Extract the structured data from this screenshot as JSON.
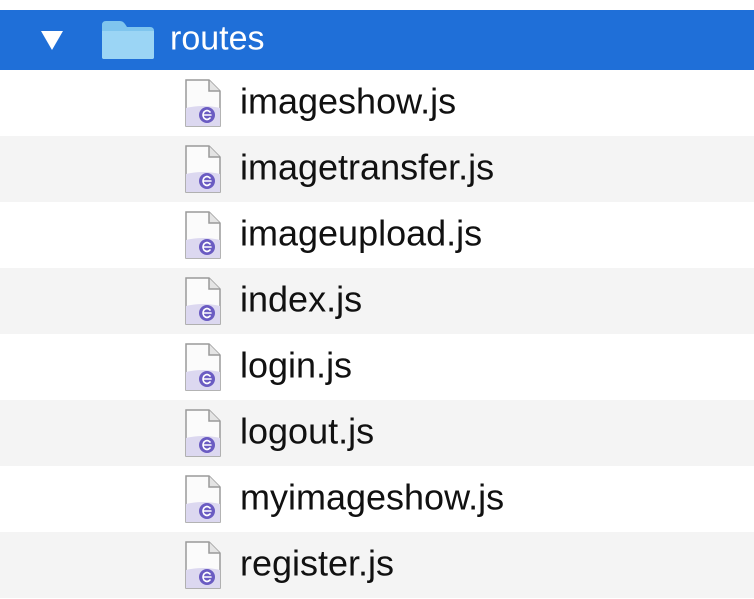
{
  "folder": {
    "name": "routes",
    "expanded": true,
    "icon": "folder-icon",
    "selected_color": "#1f6fd8"
  },
  "files": [
    {
      "name": "imageshow.js",
      "icon": "js-file-icon"
    },
    {
      "name": "imagetransfer.js",
      "icon": "js-file-icon"
    },
    {
      "name": "imageupload.js",
      "icon": "js-file-icon"
    },
    {
      "name": "index.js",
      "icon": "js-file-icon"
    },
    {
      "name": "login.js",
      "icon": "js-file-icon"
    },
    {
      "name": "logout.js",
      "icon": "js-file-icon"
    },
    {
      "name": "myimageshow.js",
      "icon": "js-file-icon"
    },
    {
      "name": "register.js",
      "icon": "js-file-icon"
    }
  ]
}
